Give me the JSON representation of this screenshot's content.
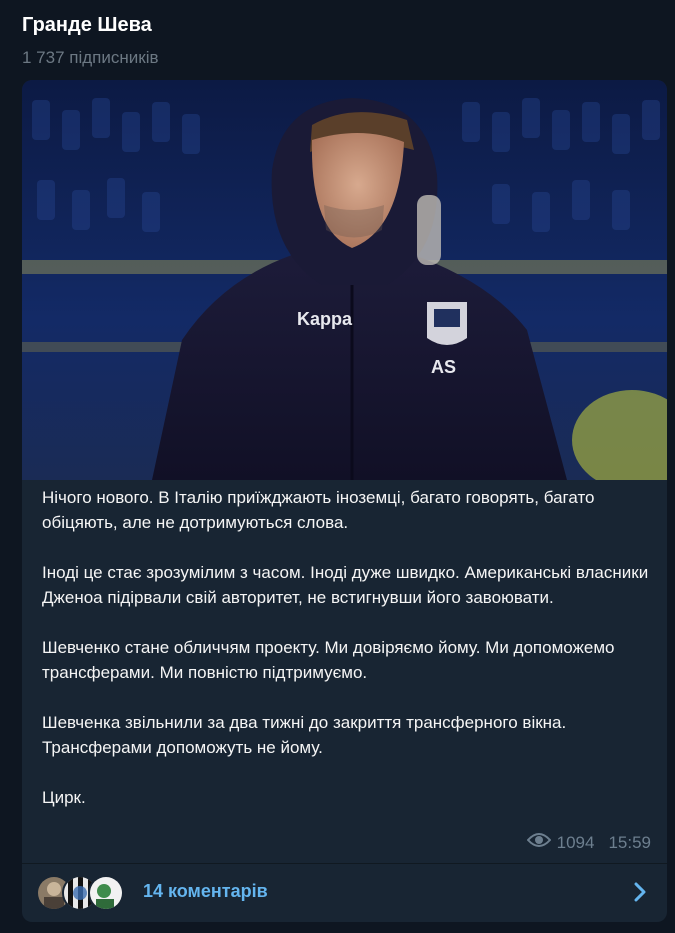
{
  "channel": {
    "title": "Гранде Шева",
    "subscribers": "1 737 підписників"
  },
  "post": {
    "photo": {
      "kit_brand": "Kappa",
      "initials": "AS"
    },
    "paragraphs": [
      "Нічого нового. В Італію приїжджають іноземці, багато говорять, багато обіцяють, але не дотримуються слова.",
      "Іноді це стає зрозумілим з часом. Іноді дуже швидко. Американські власники Дженоа підірвали свій авторитет, не встигнувши його завоювати.",
      "Шевченко стане обличчям проекту. Ми довіряємо йому. Ми допоможемо трансферами. Ми повністю підтримуємо.",
      "Шевченка звільнили за два тижні до закриття трансферного вікна. Трансферами допоможуть не йому.",
      "Цирк."
    ],
    "views": "1094",
    "time": "15:59"
  },
  "comments": {
    "label": "14 коментарів"
  },
  "colors": {
    "background": "#0e1621",
    "bubble": "#182533",
    "accent": "#64b5ef",
    "muted": "#6d7f8f"
  },
  "icons": {
    "views": "eye-icon",
    "open_comments": "chevron-right-icon"
  }
}
